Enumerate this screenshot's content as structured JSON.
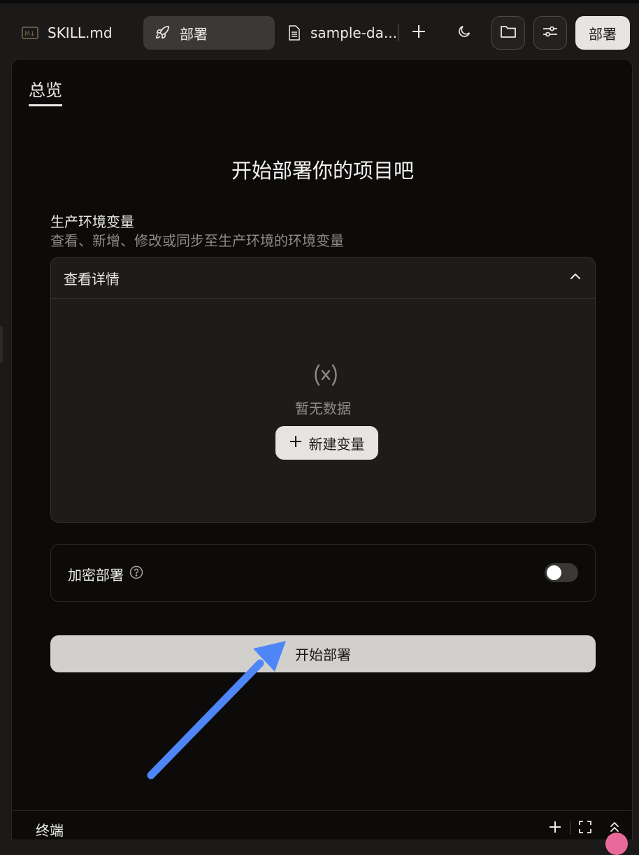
{
  "tabs": {
    "skill": {
      "label": "SKILL.md"
    },
    "deploy": {
      "label": "部署"
    },
    "sample": {
      "label": "sample-da..."
    }
  },
  "toolbar": {
    "deploy_label": "部署"
  },
  "panel": {
    "tab_overview": "总览",
    "headline": "开始部署你的项目吧",
    "env_section": {
      "title": "生产环境变量",
      "description": "查看、新增、修改或同步至生产环境的环境变量"
    },
    "details": {
      "title": "查看详情",
      "empty_text": "暂无数据",
      "new_var_label": "新建变量"
    },
    "encrypt": {
      "label": "加密部署",
      "enabled": false
    },
    "start_label": "开始部署"
  },
  "bottom": {
    "terminal_label": "终端"
  },
  "colors": {
    "accent_arrow": "#4f86f7",
    "background": "#1c1a18",
    "panel": "#0c0b0a",
    "pink_dot": "#e86a9b"
  }
}
